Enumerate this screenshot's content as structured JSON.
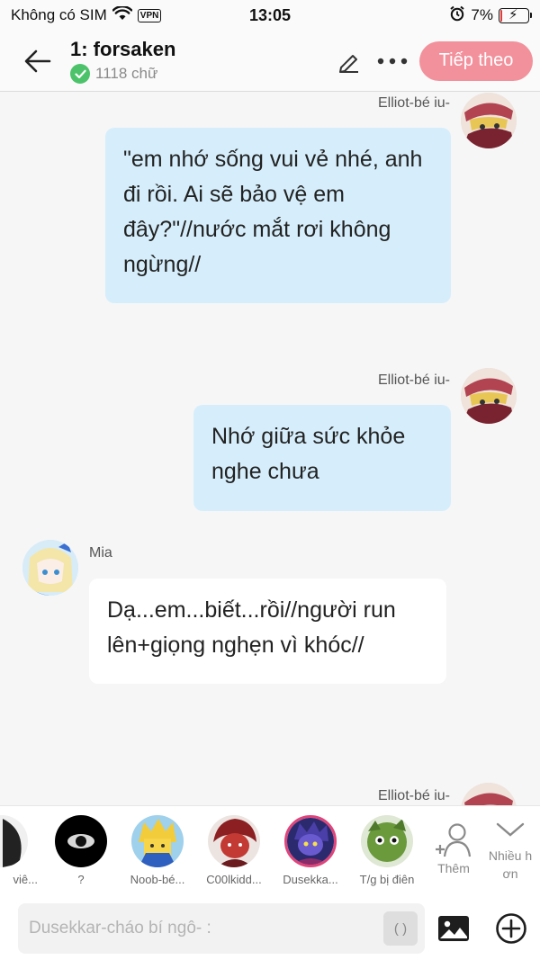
{
  "status_bar": {
    "carrier": "Không có SIM",
    "vpn": "VPN",
    "time": "13:05",
    "battery": "7%",
    "battery_level": 0.07
  },
  "header": {
    "title": "1: forsaken",
    "word_count": "1118 chữ",
    "next_label": "Tiếp theo"
  },
  "messages": [
    {
      "sender": "Elliot-bé iu-",
      "side": "right",
      "text": "\"em nhớ sống vui vẻ nhé, anh đi rồi. Ai sẽ bảo vệ em đây?\"//nước mắt rơi không ngừng//"
    },
    {
      "sender": "Elliot-bé iu-",
      "side": "right",
      "text": "Nhớ giữa sức khỏe nghe chưa"
    },
    {
      "sender": "Mia",
      "side": "left",
      "text": "Dạ...em...biết...rồi//người run lên+giọng nghẹn vì khóc//"
    },
    {
      "sender": "Elliot-bé iu-",
      "side": "right",
      "text": ""
    }
  ],
  "characters": [
    {
      "label": "viê..."
    },
    {
      "label": "?"
    },
    {
      "label": "Noob-bé..."
    },
    {
      "label": "C00lkidd..."
    },
    {
      "label": "Dusekka..."
    },
    {
      "label": "T/g bị điên"
    }
  ],
  "tools": {
    "add_label": "Thêm",
    "more_label": "Nhiều hơn"
  },
  "input": {
    "placeholder": "Dusekkar-cháo bí ngô- :",
    "paren_label": "( )"
  },
  "colors": {
    "accent": "#f2919c",
    "bubble_right": "#d6eefb",
    "bubble_left": "#ffffff",
    "verified": "#4cc36a"
  }
}
